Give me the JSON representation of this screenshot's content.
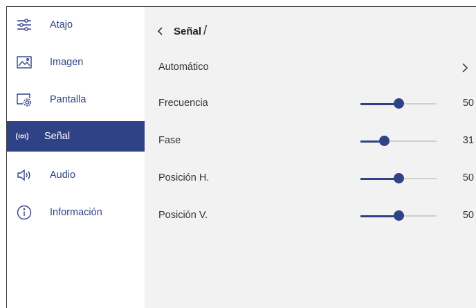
{
  "sidebar": {
    "items": [
      {
        "label": "Atajo",
        "icon": "sliders-icon",
        "active": false
      },
      {
        "label": "Imagen",
        "icon": "image-icon",
        "active": false
      },
      {
        "label": "Pantalla",
        "icon": "screen-settings-icon",
        "active": false
      },
      {
        "label": "Señal",
        "icon": "signal-icon",
        "active": true
      },
      {
        "label": "Audio",
        "icon": "speaker-icon",
        "active": false
      },
      {
        "label": "Información",
        "icon": "info-icon",
        "active": false
      }
    ]
  },
  "header": {
    "title": "Señal",
    "separator": "/"
  },
  "settings": {
    "automatic": {
      "label": "Automático"
    },
    "sliders": [
      {
        "label": "Frecuencia",
        "value": 50,
        "fill_fraction": 0.5
      },
      {
        "label": "Fase",
        "value": 31,
        "fill_fraction": 0.31
      },
      {
        "label": "Posición H.",
        "value": 50,
        "fill_fraction": 0.5
      },
      {
        "label": "Posición V.",
        "value": 50,
        "fill_fraction": 0.5
      }
    ]
  },
  "colors": {
    "accent": "#2f4285",
    "panel_bg": "#f2f2f2",
    "track": "#cfcfcf"
  }
}
